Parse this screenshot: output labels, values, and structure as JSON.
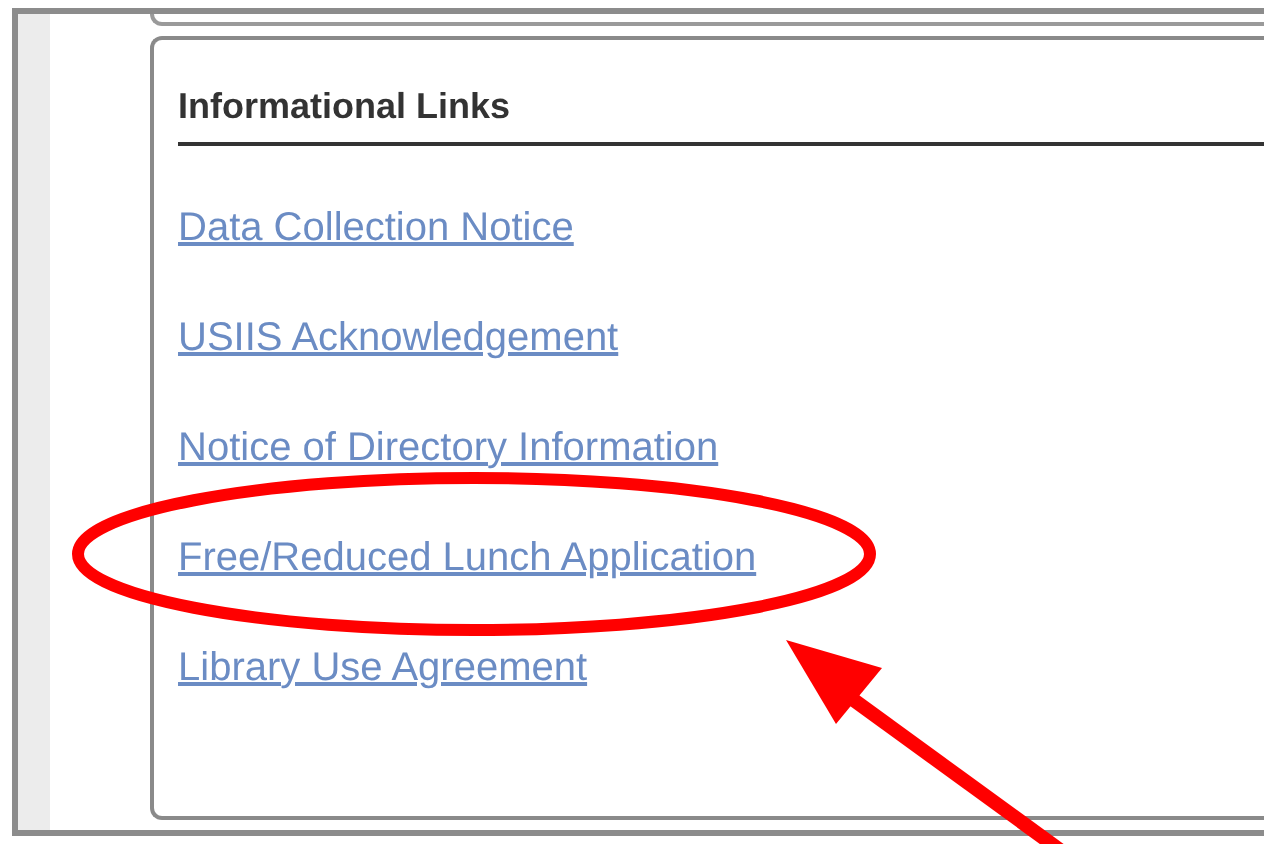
{
  "panel": {
    "title": "Informational Links",
    "links": [
      {
        "label": "Data Collection Notice"
      },
      {
        "label": "USIIS Acknowledgement"
      },
      {
        "label": "Notice of Directory Information"
      },
      {
        "label": "Free/Reduced Lunch Application"
      },
      {
        "label": "Library Use Agreement"
      }
    ]
  }
}
